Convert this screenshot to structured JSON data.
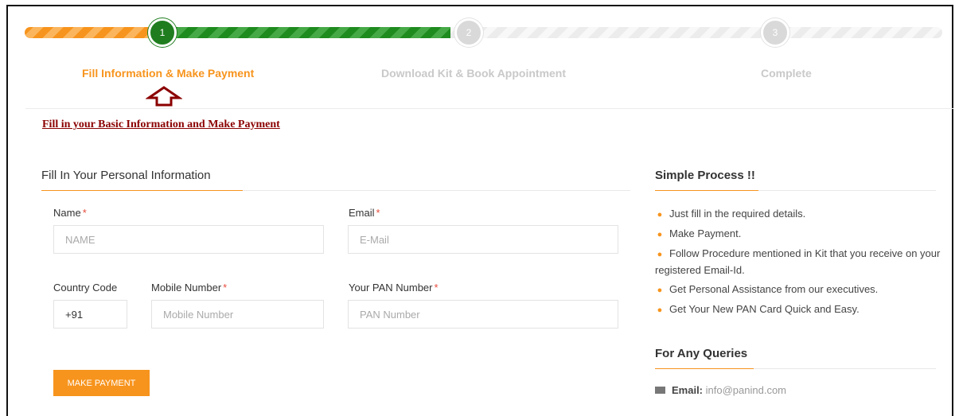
{
  "steps": [
    {
      "number": "1",
      "label": "Fill Information & Make Payment"
    },
    {
      "number": "2",
      "label": "Download Kit & Book Appointment"
    },
    {
      "number": "3",
      "label": "Complete"
    }
  ],
  "progress": {
    "active_step": 1
  },
  "notice": "Fill in your Basic Information and Make Payment",
  "form": {
    "section_title": "Fill In Your Personal Information",
    "required_mark": "*",
    "name": {
      "label": "Name",
      "placeholder": "NAME",
      "value": ""
    },
    "email": {
      "label": "Email",
      "placeholder": "E-Mail",
      "value": ""
    },
    "country_code": {
      "label": "Country Code",
      "value": "+91"
    },
    "mobile": {
      "label": "Mobile Number",
      "placeholder": "Mobile Number",
      "value": ""
    },
    "pan": {
      "label": "Your PAN Number",
      "placeholder": "PAN Number",
      "value": ""
    },
    "submit_label": "MAKE PAYMENT"
  },
  "sidebar": {
    "process_title": "Simple Process !!",
    "process_items": [
      "Just fill in the required details.",
      "Make Payment.",
      "Follow Procedure mentioned in Kit that you receive on your registered Email-Id.",
      "Get Personal Assistance from our executives.",
      "Get Your New PAN Card Quick and Easy."
    ],
    "queries_title": "For Any Queries",
    "email_label": "Email:",
    "email_value": "info@panind.com"
  },
  "colors": {
    "accent": "#f7941d",
    "success": "#1f7d1f",
    "notice": "#8b0000"
  },
  "icons": {
    "list_bullet": "map-marker-icon",
    "email": "envelope-icon",
    "indicator": "up-arrow-icon"
  }
}
